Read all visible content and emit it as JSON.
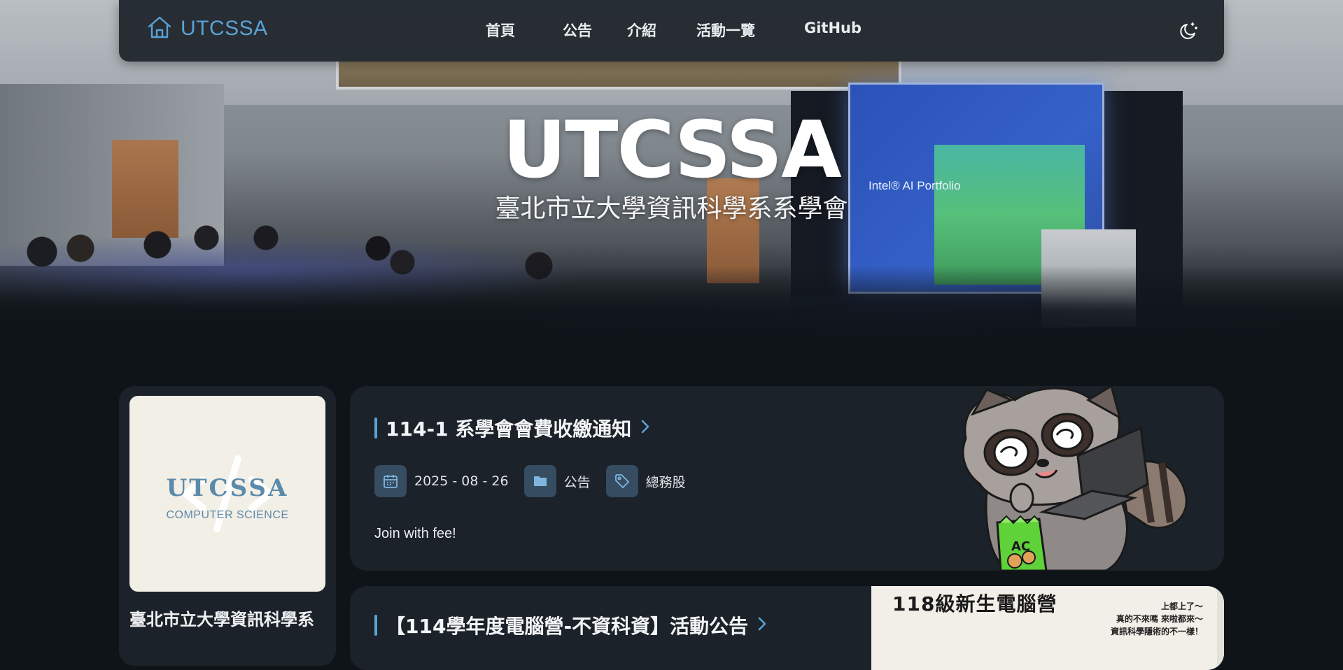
{
  "navbar": {
    "brand": "UTCSSA",
    "items": [
      {
        "label": "首頁"
      },
      {
        "label": "公告"
      },
      {
        "label": "介紹"
      },
      {
        "label": "活動一覽"
      },
      {
        "label": "GitHub"
      }
    ],
    "theme_icon": "moon-icon",
    "home_icon": "home-icon"
  },
  "hero": {
    "title": "UTCSSA",
    "subtitle": "臺北市立大學資訊科學系系學會",
    "screen_text": "Intel® AI Portfolio"
  },
  "profile": {
    "logo_main": "UTCSSA",
    "logo_sub": "COMPUTER SCIENCE",
    "name": "臺北市立大學資訊科學系"
  },
  "posts": [
    {
      "title": "114-1 系學會會費收繳通知",
      "date": "2025 - 08 - 26",
      "category": "公告",
      "tag": "總務股",
      "excerpt": "Join with fee!"
    },
    {
      "title": "【114學年度電腦營-不資科資】活動公告",
      "poster_title": "118級新生電腦營",
      "poster_lines": [
        "上都上了～",
        "真的不來嗎 來啦都來～",
        "資訊科學隱術的不一樣！"
      ]
    }
  ],
  "colors": {
    "accent": "#5aa2d6",
    "background": "#0f1419",
    "card": "#1c2229",
    "meta_icon_bg": "#354c61"
  }
}
